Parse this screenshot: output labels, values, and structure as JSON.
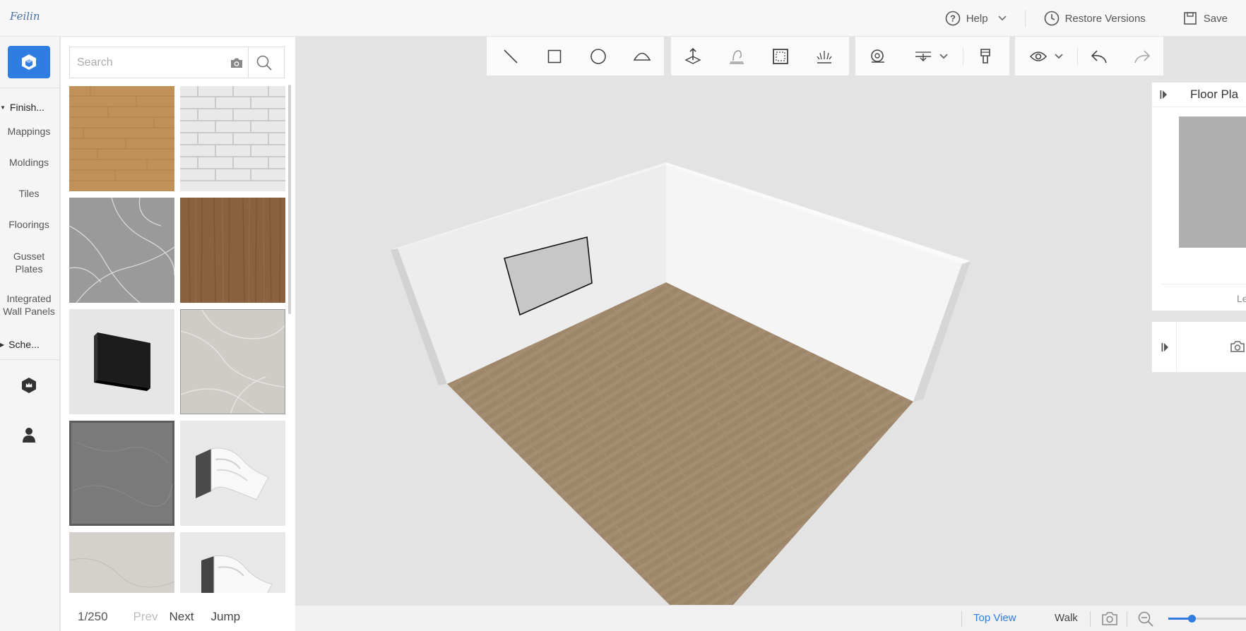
{
  "app": {
    "logo": "Feilin"
  },
  "header": {
    "help_label": "Help",
    "restore_label": "Restore Versions",
    "save_label": "Save"
  },
  "rail": {
    "group_finishes": "Finish...",
    "items": [
      "Mappings",
      "Moldings",
      "Tiles",
      "Floorings",
      "Gusset Plates",
      "Integrated Wall Panels"
    ],
    "group_schemes": "Sche..."
  },
  "panel": {
    "search_placeholder": "Search",
    "tiles": [
      {
        "name": "wood-plank-texture"
      },
      {
        "name": "white-brick-texture"
      },
      {
        "name": "grey-marble-texture"
      },
      {
        "name": "walnut-wood-texture"
      },
      {
        "name": "black-panel-model"
      },
      {
        "name": "light-marble-texture"
      },
      {
        "name": "dark-stone-tile"
      },
      {
        "name": "crown-molding-model"
      },
      {
        "name": "beige-marble-texture"
      },
      {
        "name": "crown-molding-model-2"
      }
    ],
    "pager": {
      "count": "1/250",
      "prev": "Prev",
      "next": "Next",
      "jump": "Jump"
    }
  },
  "right_panel": {
    "title": "Floor Pla",
    "footer_text": "Le"
  },
  "status": {
    "top_view": "Top View",
    "walk": "Walk",
    "zoom_level": 0.3
  },
  "colors": {
    "accent": "#2f7de1",
    "floor": "#a08a70",
    "wall": "#efefef"
  }
}
